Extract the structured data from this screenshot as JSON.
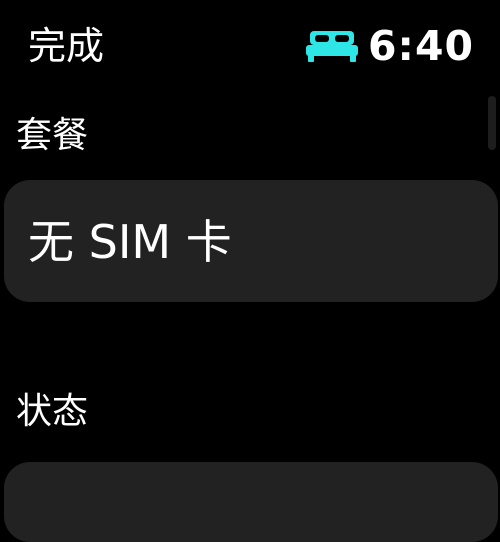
{
  "header": {
    "done_label": "完成",
    "time": "6:40",
    "sleep_icon": "bed-icon",
    "sleep_icon_color": "#2ee6e6"
  },
  "sections": {
    "plan": {
      "label": "套餐",
      "value": "无 SIM 卡"
    },
    "status": {
      "label": "状态"
    }
  }
}
